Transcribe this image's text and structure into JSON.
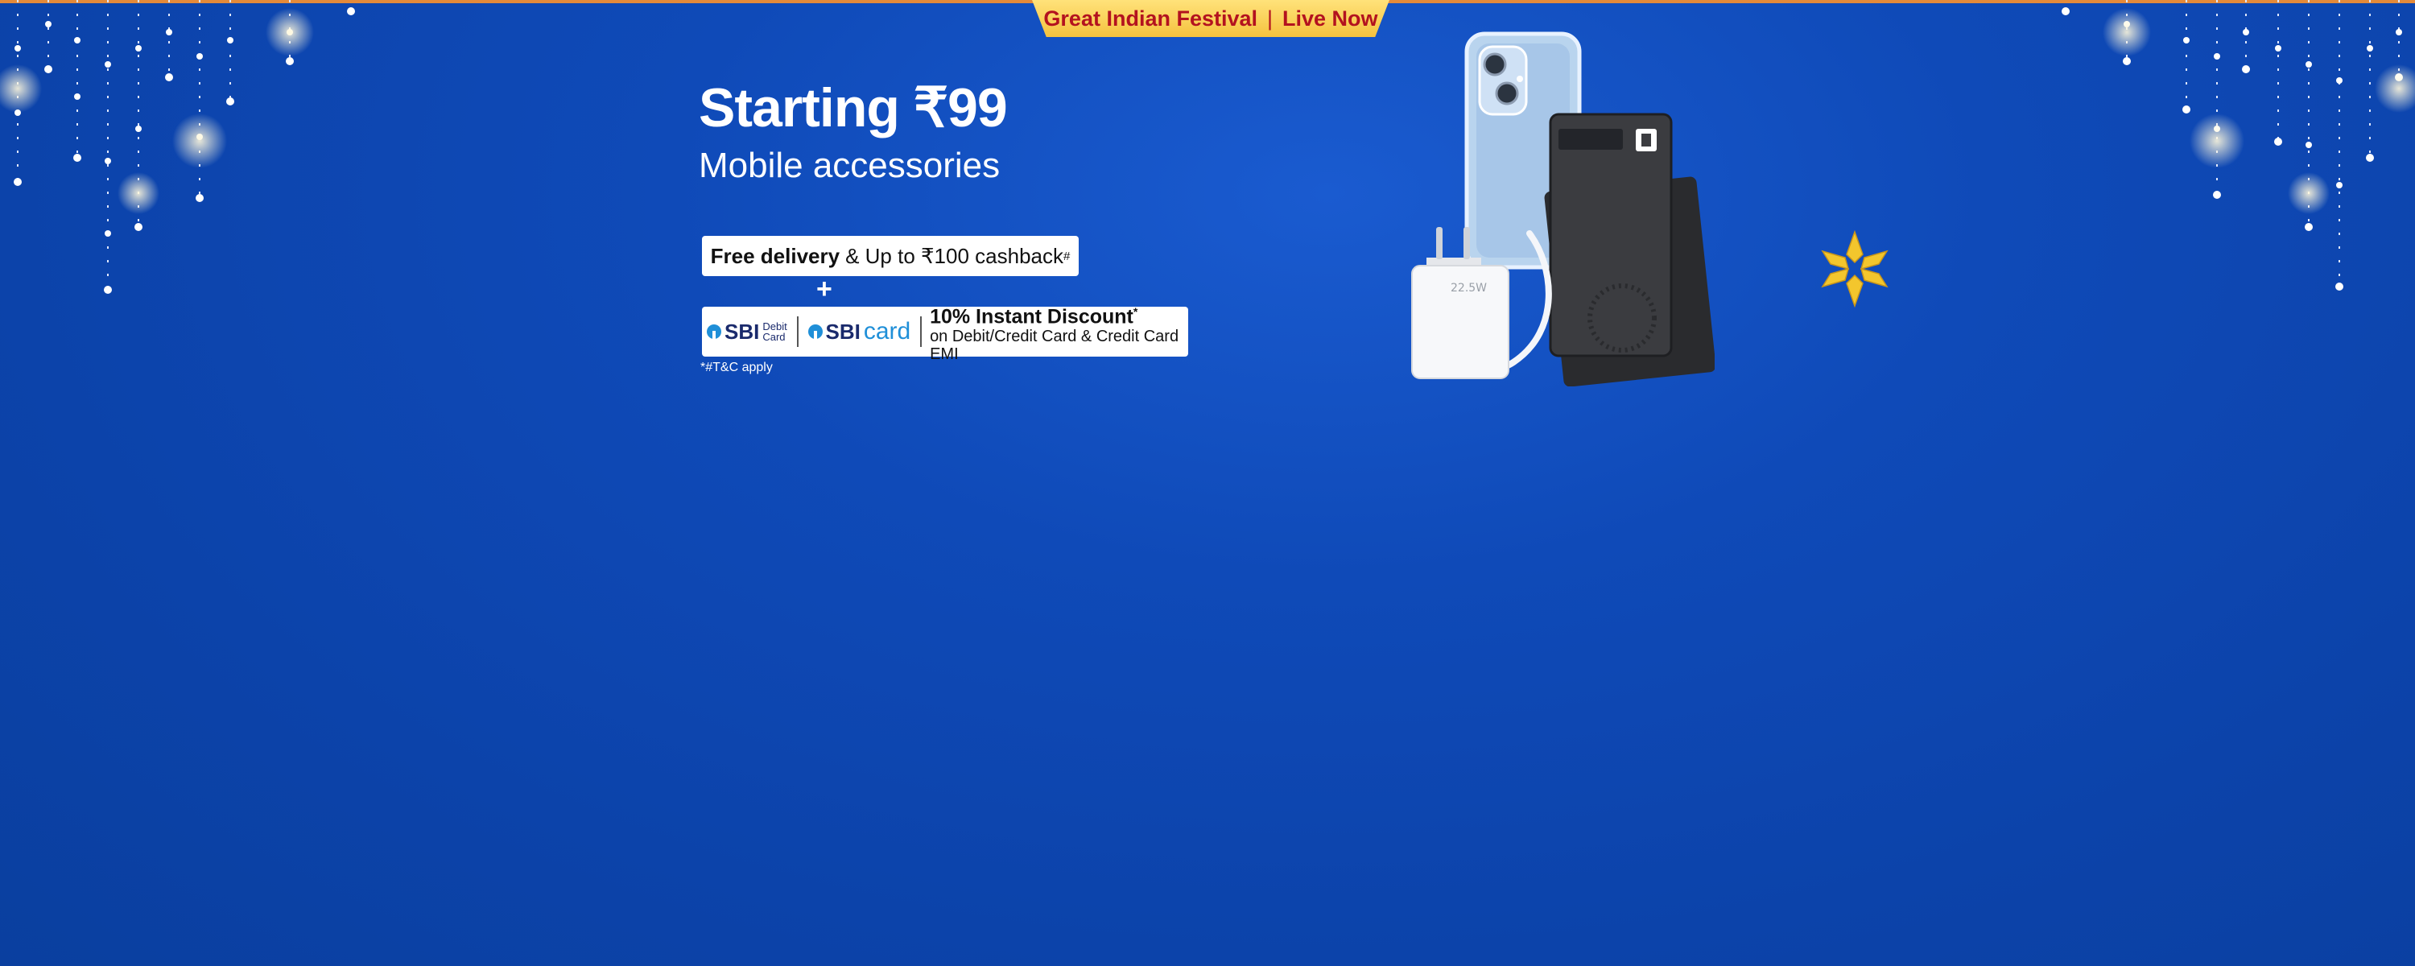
{
  "banner": {
    "tab_event": "Great Indian Festival",
    "tab_separator": "|",
    "tab_status": "Live Now",
    "headline": "Starting ₹99",
    "subhead": "Mobile accessories",
    "delivery_bold": "Free delivery",
    "delivery_rest": "& Up to ₹100 cashback",
    "delivery_mark": "#",
    "plus": "+",
    "bank": {
      "brand1": "SBI",
      "brand1_small_1": "Debit",
      "brand1_small_2": "Card",
      "brand2": "SBI",
      "brand2_card": "card",
      "discount_title": "10% Instant Discount",
      "discount_mark": "*",
      "discount_sub": "on Debit/Credit Card & Credit Card EMI"
    },
    "tnc": "*#T&C apply",
    "product_labels": {
      "charger_watts": "22.5W"
    }
  },
  "colors": {
    "background": "#0f4ab8",
    "tab_bg": "#f5c23e",
    "tab_text": "#b3121f",
    "star": "#f3c62d"
  },
  "icons": {
    "star": "eight-point-star-icon",
    "lights": "string-lights-decoration"
  }
}
